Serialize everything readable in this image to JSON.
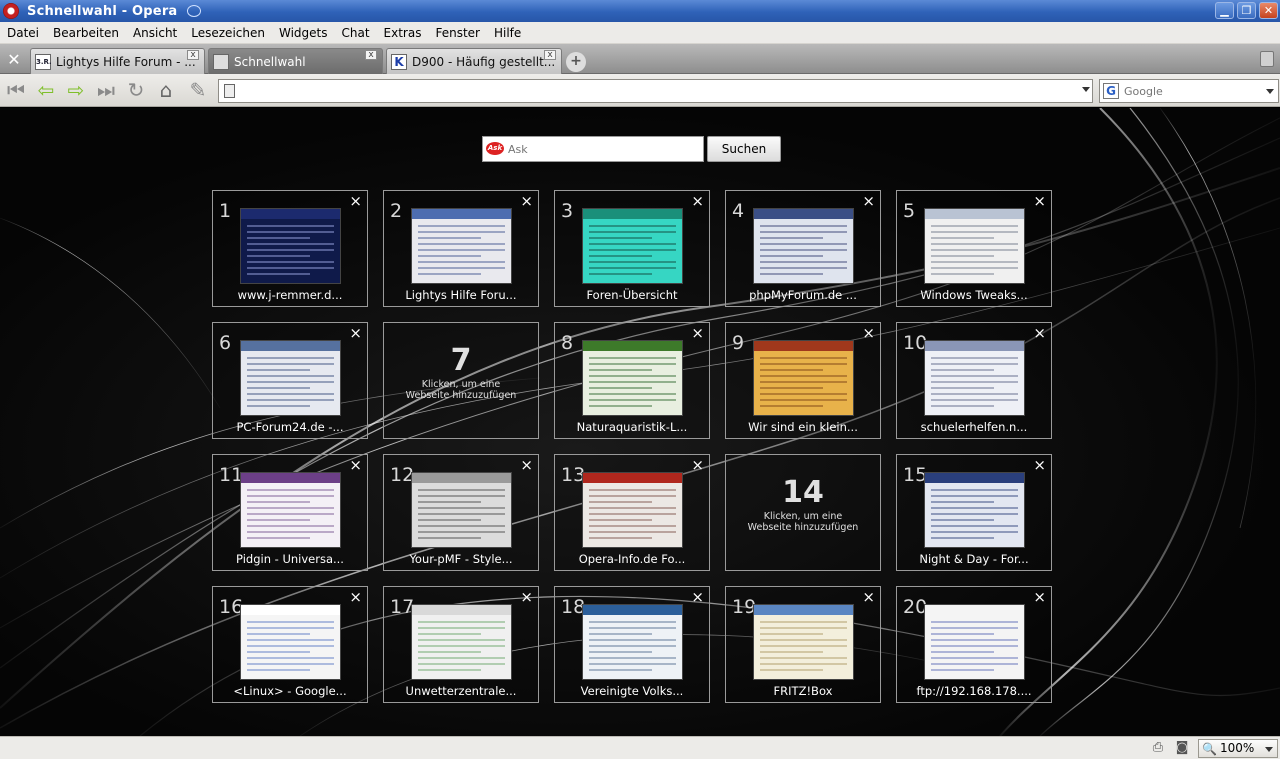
{
  "window": {
    "title": "Schnellwahl - Opera",
    "minimize_glyph": "▁",
    "restore_glyph": "❐",
    "close_glyph": "✕"
  },
  "menu": [
    "Datei",
    "Bearbeiten",
    "Ansicht",
    "Lesezeichen",
    "Widgets",
    "Chat",
    "Extras",
    "Fenster",
    "Hilfe"
  ],
  "tabs": [
    {
      "label": "Lightys Hilfe Forum - ...",
      "favicon": "3.R.",
      "active": false
    },
    {
      "label": "Schnellwahl",
      "favicon": "",
      "active": true
    },
    {
      "label": "D900 - Häufig gestellt...",
      "favicon": "K",
      "active": false
    }
  ],
  "tab_close_glyph": "x",
  "tab_add_glyph": "+",
  "toolbar": {
    "rewind_glyph": "⏮",
    "back_glyph": "⇦",
    "forward_glyph": "⇨",
    "fast_forward_glyph": "⏭",
    "reload_glyph": "↻",
    "home_glyph": "⌂",
    "edit_glyph": "✎",
    "address_value": "",
    "search_placeholder": "Google",
    "search_engine_glyph": "G"
  },
  "speed_dial": {
    "ask_placeholder": "Ask",
    "ask_logo": "Ask",
    "search_button": "Suchen",
    "close_glyph": "×",
    "empty_text": "Klicken, um eine Webseite hinzuzufügen",
    "items": [
      {
        "num": "1",
        "label": "www.j-remmer.d...",
        "empty": false,
        "thumb": "#0f1a4a",
        "thumb_header": "#1c2a6e",
        "row_color": "rgba(150,160,220,0.5)"
      },
      {
        "num": "2",
        "label": "Lightys Hilfe Foru...",
        "empty": false,
        "thumb": "#e9e9ee",
        "thumb_header": "#4d6db0",
        "row_color": "rgba(60,80,140,0.45)"
      },
      {
        "num": "3",
        "label": "Foren-Übersicht",
        "empty": false,
        "thumb": "#36d6c3",
        "thumb_header": "#1a8f7a",
        "row_color": "rgba(20,80,70,0.5)"
      },
      {
        "num": "4",
        "label": "phpMyForum.de ...",
        "empty": false,
        "thumb": "#dfe4ee",
        "thumb_header": "#3b4f86",
        "row_color": "rgba(50,60,110,0.45)"
      },
      {
        "num": "5",
        "label": "Windows Tweaks...",
        "empty": false,
        "thumb": "#f0f0f0",
        "thumb_header": "#b9c3d3",
        "row_color": "rgba(90,100,120,0.4)"
      },
      {
        "num": "6",
        "label": "PC-Forum24.de -...",
        "empty": false,
        "thumb": "#e6e9f0",
        "thumb_header": "#56719f",
        "row_color": "rgba(50,70,120,0.45)"
      },
      {
        "num": "7",
        "label": "",
        "empty": true
      },
      {
        "num": "8",
        "label": "Naturaquaristik-L...",
        "empty": false,
        "thumb": "#e8efe0",
        "thumb_header": "#3d7a2a",
        "row_color": "rgba(40,100,40,0.45)"
      },
      {
        "num": "9",
        "label": "Wir sind ein klein...",
        "empty": false,
        "thumb": "#e8b24a",
        "thumb_header": "#a0381c",
        "row_color": "rgba(120,60,20,0.45)"
      },
      {
        "num": "10",
        "label": "schuelerhelfen.n...",
        "empty": false,
        "thumb": "#eef0f6",
        "thumb_header": "#8a96b6",
        "row_color": "rgba(70,80,120,0.4)"
      },
      {
        "num": "11",
        "label": "Pidgin - Universa...",
        "empty": false,
        "thumb": "#f4f0f6",
        "thumb_header": "#6c3f87",
        "row_color": "rgba(100,60,130,0.4)"
      },
      {
        "num": "12",
        "label": "Your-pMF - Style...",
        "empty": false,
        "thumb": "#dcdcdc",
        "thumb_header": "#9a9a9a",
        "row_color": "rgba(70,70,70,0.45)"
      },
      {
        "num": "13",
        "label": "Opera-Info.de Fo...",
        "empty": false,
        "thumb": "#ece8e4",
        "thumb_header": "#b0271d",
        "row_color": "rgba(110,60,50,0.4)"
      },
      {
        "num": "14",
        "label": "",
        "empty": true
      },
      {
        "num": "15",
        "label": "Night & Day - For...",
        "empty": false,
        "thumb": "#e3e7f1",
        "thumb_header": "#2a3f7c",
        "row_color": "rgba(40,60,120,0.45)"
      },
      {
        "num": "16",
        "label": "<Linux> - Google...",
        "empty": false,
        "thumb": "#f5f5f5",
        "thumb_header": "#ffffff",
        "row_color": "rgba(40,80,180,0.35)"
      },
      {
        "num": "17",
        "label": "Unwetterzentrale...",
        "empty": false,
        "thumb": "#f0f0f0",
        "thumb_header": "#d9d9d9",
        "row_color": "rgba(60,140,60,0.35)"
      },
      {
        "num": "18",
        "label": "Vereinigte Volks...",
        "empty": false,
        "thumb": "#eef2f6",
        "thumb_header": "#2c5f9a",
        "row_color": "rgba(60,90,130,0.4)"
      },
      {
        "num": "19",
        "label": "FRITZ!Box",
        "empty": false,
        "thumb": "#f3efdc",
        "thumb_header": "#5a86c2",
        "row_color": "rgba(160,140,80,0.4)"
      },
      {
        "num": "20",
        "label": "ftp://192.168.178....",
        "empty": false,
        "thumb": "#f4f4f4",
        "thumb_header": "#f4f4f4",
        "row_color": "rgba(40,60,160,0.35)"
      }
    ]
  },
  "status": {
    "zoom": "100%",
    "zoom_glyph": "🔍",
    "device_glyph": "⎙",
    "camera_glyph": "◙"
  },
  "colors": {
    "titlebar": "#2f62b8",
    "background": "#000000",
    "dial_border": "#9a9a9a"
  }
}
